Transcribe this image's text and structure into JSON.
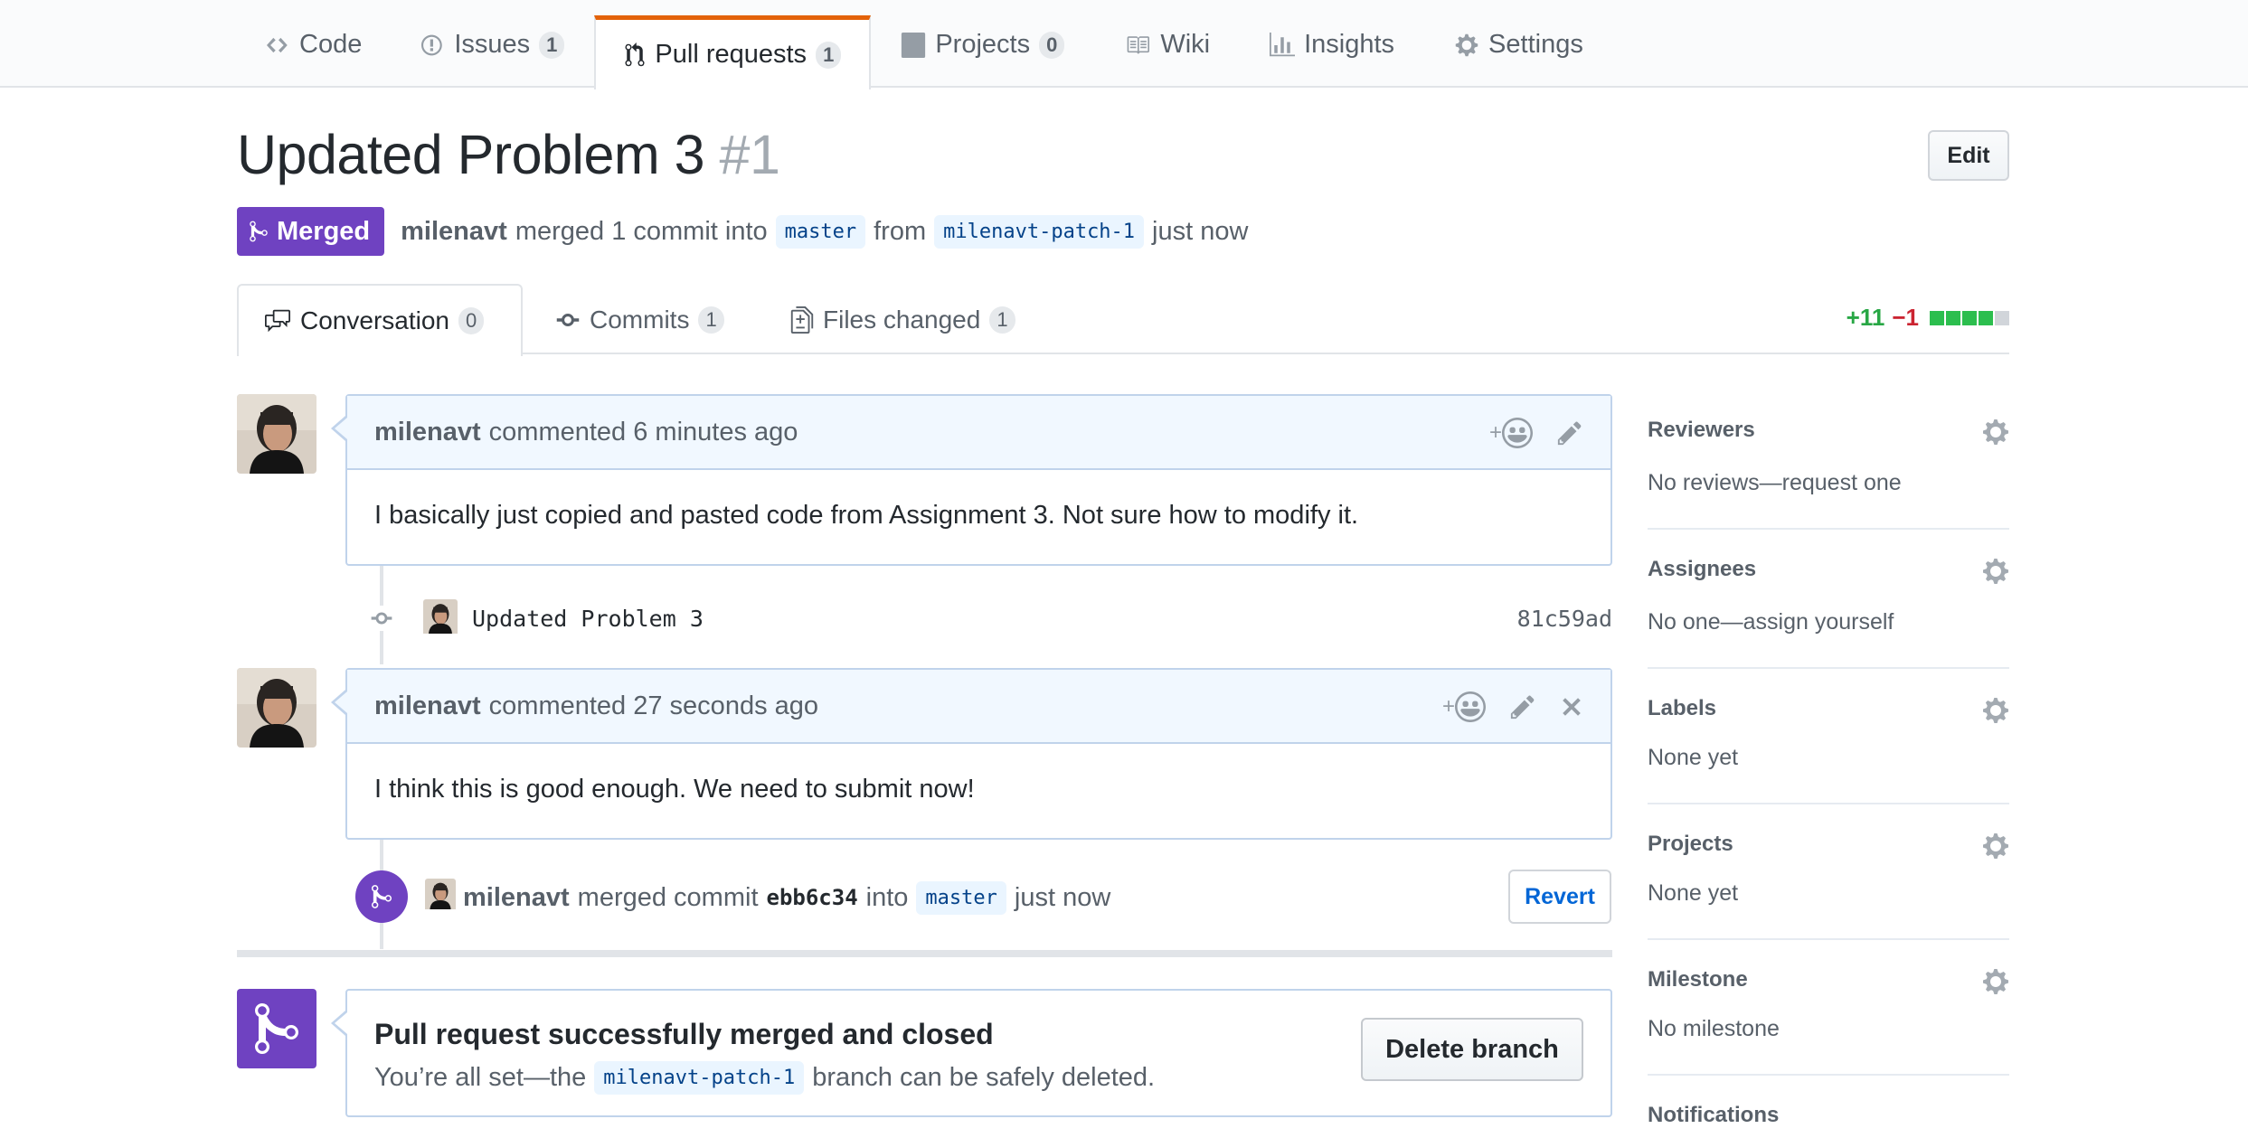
{
  "reponav": {
    "items": [
      {
        "label": "Code",
        "icon": "code-icon"
      },
      {
        "label": "Issues",
        "icon": "issue-icon",
        "count": "1"
      },
      {
        "label": "Pull requests",
        "icon": "pull-request-icon",
        "count": "1",
        "selected": true
      },
      {
        "label": "Projects",
        "icon": "project-icon",
        "count": "0"
      },
      {
        "label": "Wiki",
        "icon": "book-icon"
      },
      {
        "label": "Insights",
        "icon": "graph-icon"
      },
      {
        "label": "Settings",
        "icon": "gear-icon"
      }
    ]
  },
  "header": {
    "title": "Updated Problem 3",
    "number": "#1",
    "edit_label": "Edit",
    "state": "Merged",
    "author": "milenavt",
    "action_text": "merged 1 commit into",
    "base_branch": "master",
    "from_text": "from",
    "head_branch": "milenavt-patch-1",
    "time": "just now"
  },
  "tabs": [
    {
      "label": "Conversation",
      "count": "0",
      "icon": "comment-discussion-icon",
      "selected": true
    },
    {
      "label": "Commits",
      "count": "1",
      "icon": "commit-icon"
    },
    {
      "label": "Files changed",
      "count": "1",
      "icon": "diff-icon"
    }
  ],
  "diffstat": {
    "additions": "+11",
    "deletions": "−1",
    "blocks": [
      "#2cbe4e",
      "#2cbe4e",
      "#2cbe4e",
      "#2cbe4e",
      "#d1d5da"
    ]
  },
  "timeline": {
    "comment1": {
      "author": "milenavt",
      "meta": "commented 6 minutes ago",
      "body": "I basically just copied and pasted code from Assignment 3. Not sure how to modify it.",
      "reaction_plus": "+"
    },
    "commit": {
      "message": "Updated Problem 3",
      "sha": "81c59ad"
    },
    "comment2": {
      "author": "milenavt",
      "meta": "commented 27 seconds ago",
      "body": "I think this is good enough. We need to submit now!",
      "reaction_plus": "+"
    },
    "merged_event": {
      "author": "milenavt",
      "text1": "merged commit",
      "sha": "ebb6c34",
      "text2": "into",
      "branch": "master",
      "time": "just now",
      "revert_label": "Revert"
    }
  },
  "merge_box": {
    "title": "Pull request successfully merged and closed",
    "sub_prefix": "You’re all set—the",
    "branch": "milenavt-patch-1",
    "sub_suffix": "branch can be safely deleted.",
    "delete_label": "Delete branch"
  },
  "sidebar": {
    "reviewers": {
      "heading": "Reviewers",
      "value": "No reviews—request one"
    },
    "assignees": {
      "heading": "Assignees",
      "value": "No one—assign yourself"
    },
    "labels": {
      "heading": "Labels",
      "value": "None yet"
    },
    "projects": {
      "heading": "Projects",
      "value": "None yet"
    },
    "milestone": {
      "heading": "Milestone",
      "value": "No milestone"
    },
    "notifications": {
      "heading": "Notifications"
    }
  },
  "colors": {
    "merged_purple": "#6f42c1",
    "accent_orange": "#e36209",
    "link_blue": "#0366d6"
  }
}
